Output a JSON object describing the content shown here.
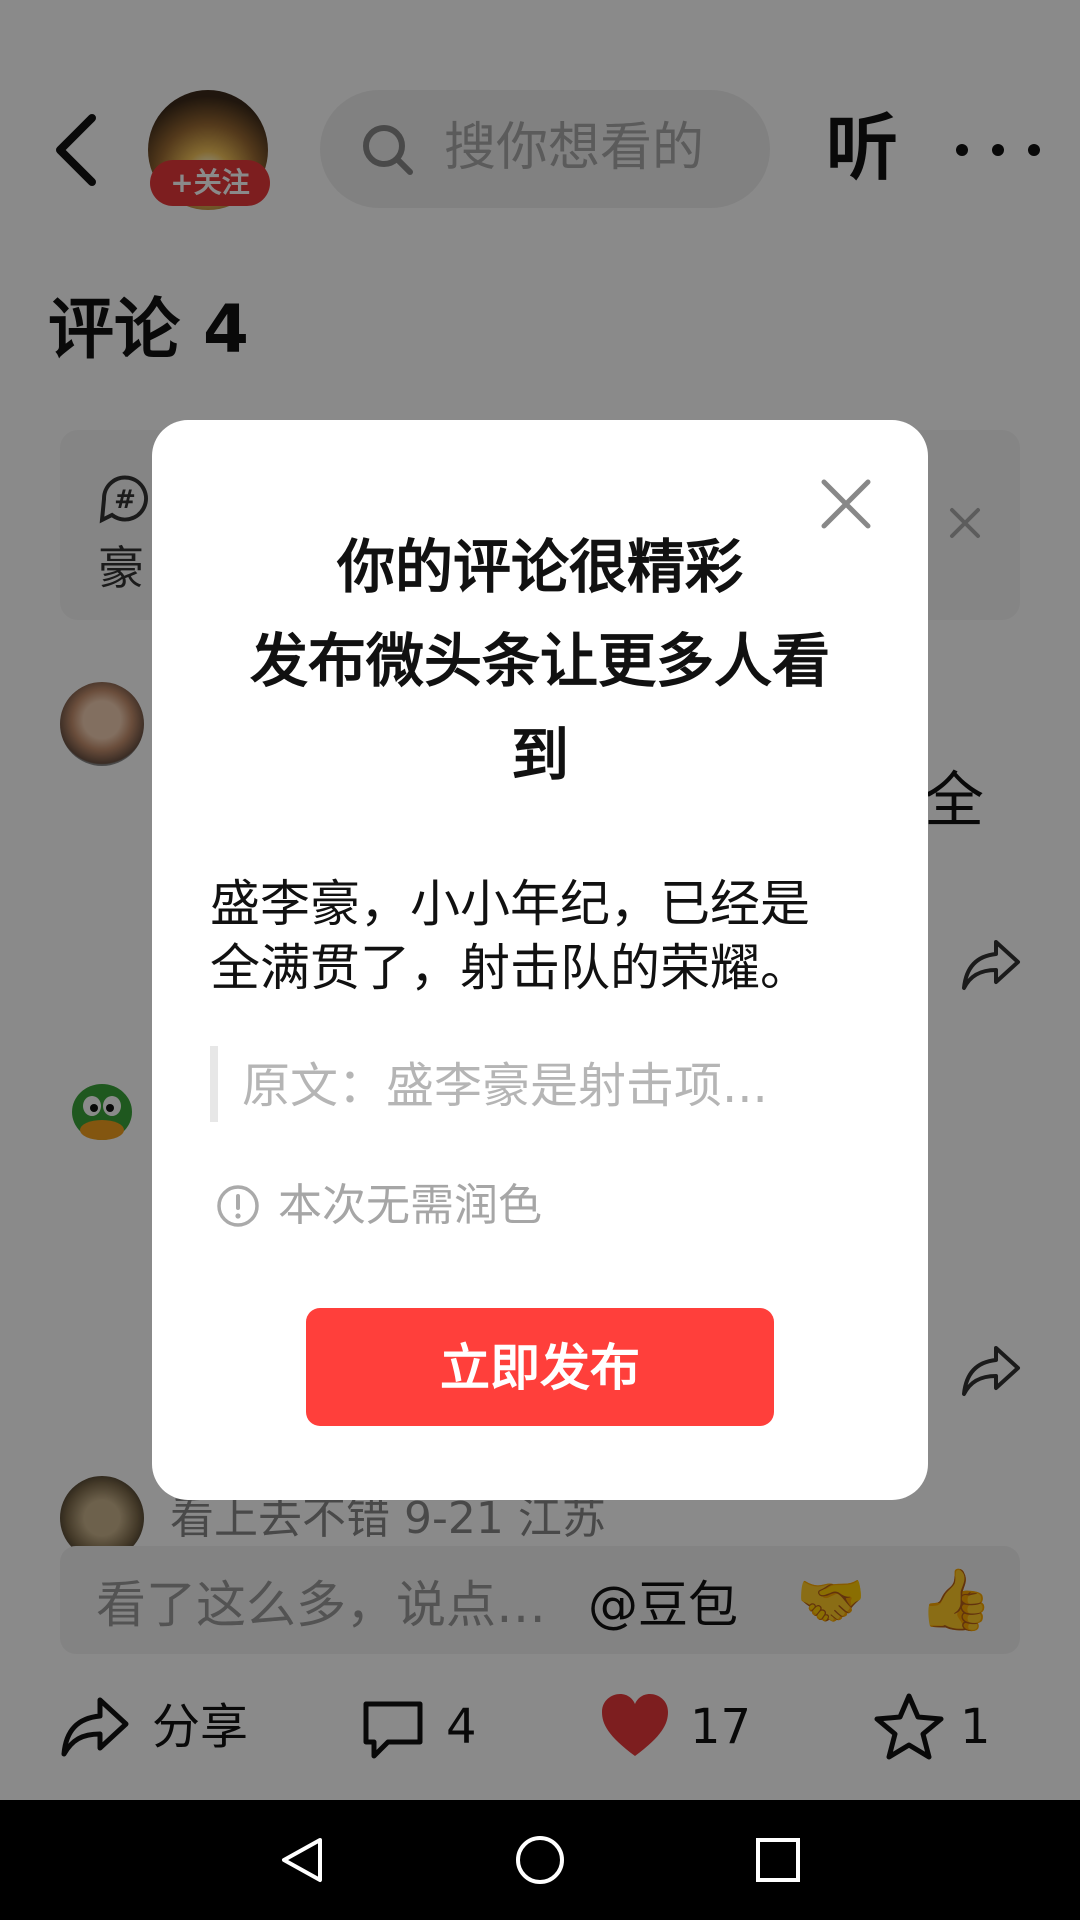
{
  "header": {
    "follow_label": "+关注",
    "search_placeholder": "搜你想看的",
    "listen_label": "听"
  },
  "comments": {
    "title": "评论 4",
    "topic_text": "豪",
    "comment_fragment": "全",
    "bottom_fragment": "看上去不错 9-21 江苏"
  },
  "input_bar": {
    "placeholder": "看了这么多，说点…",
    "mention": "@豆包",
    "emoji_handshake": "🤝",
    "emoji_thumb": "👍"
  },
  "action_bar": {
    "share_label": "分享",
    "comment_count": "4",
    "like_count": "17",
    "favorite_count": "1",
    "heart_color": "#e8383a"
  },
  "modal": {
    "title_line1": "你的评论很精彩",
    "title_line2": "发布微头条让更多人看",
    "title_line3": "到",
    "body_line1": "盛李豪，小小年纪，已经是",
    "body_line2": "全满贯了，射击队的荣耀。",
    "quote": "原文：盛李豪是射击项...",
    "info": "本次无需润色",
    "publish_label": "立即发布",
    "button_color": "#ff3f3b"
  }
}
